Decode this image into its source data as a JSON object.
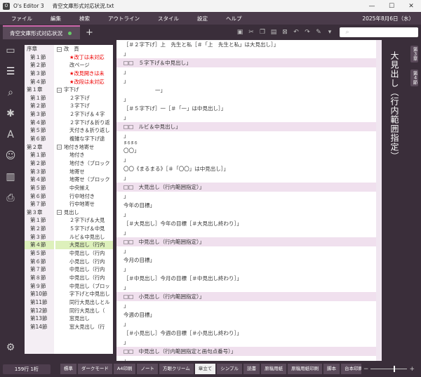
{
  "window": {
    "app": "O's Editor 3",
    "file": "青空文庫形式対応状況.txt"
  },
  "menu": [
    "ファイル",
    "編集",
    "検索",
    "アウトライン",
    "スタイル",
    "設定",
    "ヘルプ"
  ],
  "date": "2025年8月6日（水）",
  "tab": {
    "label": "青空文庫形式対応状況"
  },
  "search": {
    "placeholder": ""
  },
  "chapters": [
    {
      "label": "序章",
      "type": "ch"
    },
    {
      "label": "第１節",
      "type": "sec"
    },
    {
      "label": "第２節",
      "type": "sec"
    },
    {
      "label": "第３節",
      "type": "sec"
    },
    {
      "label": "第４節",
      "type": "sec"
    },
    {
      "label": "第１章",
      "type": "ch"
    },
    {
      "label": "第１節",
      "type": "sec"
    },
    {
      "label": "第２節",
      "type": "sec"
    },
    {
      "label": "第３節",
      "type": "sec"
    },
    {
      "label": "第４節",
      "type": "sec"
    },
    {
      "label": "第５節",
      "type": "sec"
    },
    {
      "label": "第６節",
      "type": "sec"
    },
    {
      "label": "第２章",
      "type": "ch"
    },
    {
      "label": "第１節",
      "type": "sec"
    },
    {
      "label": "第２節",
      "type": "sec"
    },
    {
      "label": "第３節",
      "type": "sec"
    },
    {
      "label": "第４節",
      "type": "sec"
    },
    {
      "label": "第５節",
      "type": "sec"
    },
    {
      "label": "第６節",
      "type": "sec"
    },
    {
      "label": "第７節",
      "type": "sec"
    },
    {
      "label": "第３章",
      "type": "ch"
    },
    {
      "label": "第１節",
      "type": "sec"
    },
    {
      "label": "第２節",
      "type": "sec"
    },
    {
      "label": "第３節",
      "type": "sec"
    },
    {
      "label": "第４節",
      "type": "sec",
      "active": true
    },
    {
      "label": "第５節",
      "type": "sec"
    },
    {
      "label": "第６節",
      "type": "sec"
    },
    {
      "label": "第７節",
      "type": "sec"
    },
    {
      "label": "第８節",
      "type": "sec"
    },
    {
      "label": "第９節",
      "type": "sec"
    },
    {
      "label": "第10節",
      "type": "sec"
    },
    {
      "label": "第11節",
      "type": "sec"
    },
    {
      "label": "第12節",
      "type": "sec"
    },
    {
      "label": "第13節",
      "type": "sec"
    },
    {
      "label": "第14節",
      "type": "sec"
    }
  ],
  "tree": [
    {
      "label": "改　頁",
      "type": "head"
    },
    {
      "label": "★改丁は未対応",
      "type": "item",
      "red": true
    },
    {
      "label": "改ページ",
      "type": "item"
    },
    {
      "label": "★改見開きは未",
      "type": "item",
      "red": true
    },
    {
      "label": "★改段は未対応",
      "type": "item",
      "red": true
    },
    {
      "label": "字下げ",
      "type": "head"
    },
    {
      "label": "２字下げ",
      "type": "item"
    },
    {
      "label": "３字下げ",
      "type": "item"
    },
    {
      "label": "２字下げ＆４字",
      "type": "item"
    },
    {
      "label": "２字下げ＆折り返",
      "type": "item"
    },
    {
      "label": "天付き＆折り返し",
      "type": "item"
    },
    {
      "label": "複雑な字下げ途",
      "type": "item"
    },
    {
      "label": "地付き地寄せ",
      "type": "head"
    },
    {
      "label": "地付き",
      "type": "item"
    },
    {
      "label": "地付き（ブロック",
      "type": "item"
    },
    {
      "label": "地寄せ",
      "type": "item"
    },
    {
      "label": "地寄せ（ブロック",
      "type": "item"
    },
    {
      "label": "中央揃え",
      "type": "item"
    },
    {
      "label": "行中地付き",
      "type": "item"
    },
    {
      "label": "行中地寄せ",
      "type": "item"
    },
    {
      "label": "見出し",
      "type": "head"
    },
    {
      "label": "２字下げ＆大見",
      "type": "item"
    },
    {
      "label": "５字下げ＆中見",
      "type": "item"
    },
    {
      "label": "ルビ＆中見出し",
      "type": "item"
    },
    {
      "label": "大見出し（行内",
      "type": "item",
      "active": true
    },
    {
      "label": "中見出し（行内",
      "type": "item"
    },
    {
      "label": "小見出し（行内",
      "type": "item"
    },
    {
      "label": "中見出し（行内",
      "type": "item"
    },
    {
      "label": "中見出し（行内",
      "type": "item"
    },
    {
      "label": "中見出し（ブロッ",
      "type": "item"
    },
    {
      "label": "字下げと中見出し",
      "type": "item"
    },
    {
      "label": "同行大見出しとル",
      "type": "item"
    },
    {
      "label": "同行大見出し（",
      "type": "item"
    },
    {
      "label": "窓見出し",
      "type": "item"
    },
    {
      "label": "窓大見出し（行",
      "type": "item"
    }
  ],
  "editor_lines": [
    {
      "text": "［＃２字下げ］上　先生と私［＃「上　先生と私」は大見出し］",
      "hl": false
    },
    {
      "text": "",
      "hl": false
    },
    {
      "text": "□□　５字下げ＆中見出し",
      "hl": true
    },
    {
      "text": "",
      "hl": false
    },
    {
      "text": "",
      "hl": false
    },
    {
      "text": "　　　　　　一",
      "hl": false
    },
    {
      "text": "",
      "hl": false
    },
    {
      "text": "［＃５字下げ］一［＃「一」は中見出し］",
      "hl": false
    },
    {
      "text": "",
      "hl": false
    },
    {
      "text": "□□　ルビ＆中見出し",
      "hl": true
    },
    {
      "text": "",
      "hl": false
    },
    {
      "text": "まるまる",
      "hl": false,
      "rub": true
    },
    {
      "text": "〇〇",
      "hl": false
    },
    {
      "text": "",
      "hl": false
    },
    {
      "text": "〇〇《まるまる》［＃「〇〇」は中見出し］",
      "hl": false
    },
    {
      "text": "",
      "hl": false
    },
    {
      "text": "□□　大見出し（行内範囲指定）",
      "hl": true
    },
    {
      "text": "",
      "hl": false
    },
    {
      "text": "今年の目標",
      "hl": false
    },
    {
      "text": "",
      "hl": false
    },
    {
      "text": "［＃大見出し］今年の目標［＃大見出し終わり］",
      "hl": false
    },
    {
      "text": "",
      "hl": false
    },
    {
      "text": "□□　中見出し（行内範囲指定）",
      "hl": true
    },
    {
      "text": "",
      "hl": false
    },
    {
      "text": "今月の目標",
      "hl": false
    },
    {
      "text": "",
      "hl": false
    },
    {
      "text": "［＃中見出し］今月の目標［＃中見出し終わり］",
      "hl": false
    },
    {
      "text": "",
      "hl": false
    },
    {
      "text": "□□　小見出し（行内範囲指定）",
      "hl": true
    },
    {
      "text": "",
      "hl": false
    },
    {
      "text": "今週の目標",
      "hl": false
    },
    {
      "text": "",
      "hl": false
    },
    {
      "text": "［＃小見出し］今週の目標［＃小見出し終わり］",
      "hl": false
    },
    {
      "text": "",
      "hl": false
    },
    {
      "text": "□□　中見出し（行内範囲指定と画句点番号）",
      "hl": true
    },
    {
      "text": "",
      "hl": false
    }
  ],
  "vertical": {
    "title": "大見出し（行内範囲指定）",
    "tag1": "第３章",
    "tag2": "第４節"
  },
  "status": {
    "position": "159行 1桁"
  },
  "modes": [
    "標準",
    "ダークモード",
    "A4印刷",
    "ノート",
    "方眼クリーム",
    "章立て",
    "シンプル",
    "読書",
    "原稿用紙",
    "原稿用紙印刷",
    "脚本",
    "台本印刷",
    "台本"
  ],
  "active_mode": 5,
  "zoom_level": 0.62
}
